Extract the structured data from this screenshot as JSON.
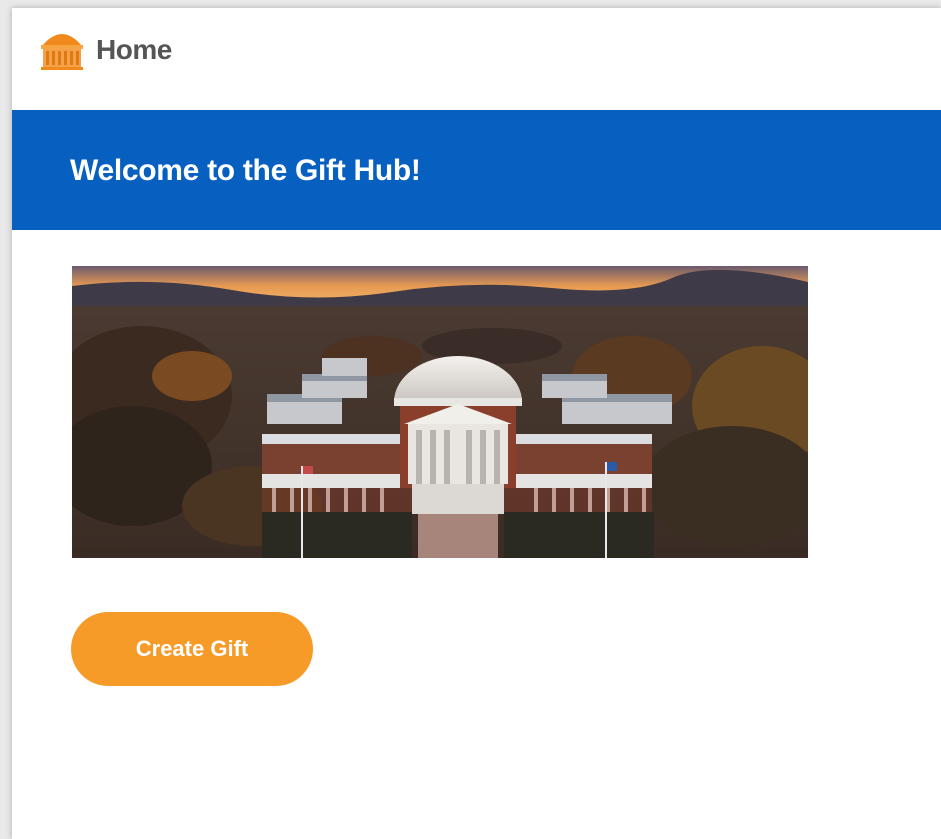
{
  "header": {
    "title": "Home",
    "logo_icon": "rotunda-logo-icon"
  },
  "banner": {
    "title": "Welcome to the Gift Hub!"
  },
  "hero": {
    "image_icon": "campus-rotunda-photo"
  },
  "actions": {
    "create_gift_label": "Create Gift"
  },
  "colors": {
    "banner_blue": "#0760c0",
    "accent_orange": "#f79b28",
    "title_gray": "#555555"
  }
}
